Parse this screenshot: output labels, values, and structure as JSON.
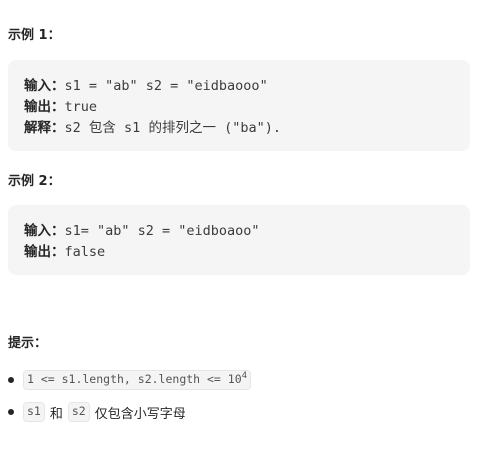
{
  "example1": {
    "heading": "示例 1：",
    "input_label": "输入：",
    "input_value": "s1 = \"ab\" s2 = \"eidbaooo\"",
    "output_label": "输出：",
    "output_value": "true",
    "explain_label": "解释：",
    "explain_parts": [
      "s2",
      "包含",
      "s1",
      "的排列之一",
      "(\"ba\")."
    ]
  },
  "example2": {
    "heading": "示例 2：",
    "input_label": "输入：",
    "input_value": "s1= \"ab\" s2 = \"eidboaoo\"",
    "output_label": "输出：",
    "output_value": "false"
  },
  "hints": {
    "heading": "提示：",
    "constraint_code": "1 <= s1.length, s2.length <= 10",
    "constraint_exponent": "4",
    "item2_code_a": "s1",
    "item2_and": "和",
    "item2_code_b": "s2",
    "item2_text": "仅包含小写字母"
  }
}
